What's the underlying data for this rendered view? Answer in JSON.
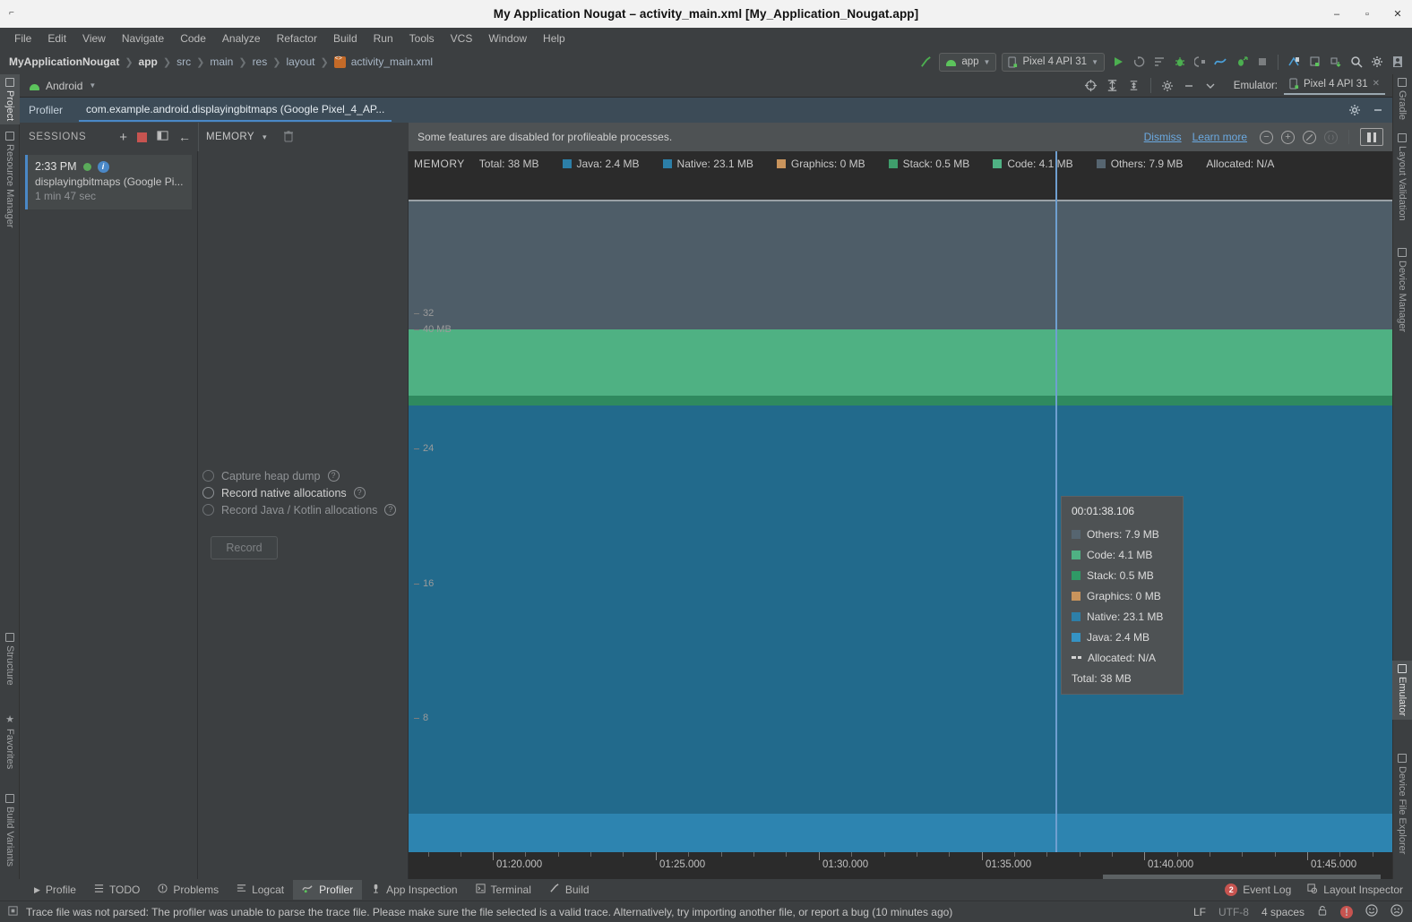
{
  "window": {
    "title": "My Application Nougat – activity_main.xml [My_Application_Nougat.app]",
    "minimize": "‒",
    "maximize": "▫",
    "close": "✕"
  },
  "menu": [
    "File",
    "Edit",
    "View",
    "Navigate",
    "Code",
    "Analyze",
    "Refactor",
    "Build",
    "Run",
    "Tools",
    "VCS",
    "Window",
    "Help"
  ],
  "breadcrumbs": [
    "MyApplicationNougat",
    "app",
    "src",
    "main",
    "res",
    "layout",
    "activity_main.xml"
  ],
  "toolbar": {
    "run_config": "app",
    "device": "Pixel 4 API 31",
    "icons": [
      "build-hammer-icon",
      "run-icon",
      "run-coverage-icon",
      "profile-icon",
      "debug-icon",
      "attach-debugger-icon",
      "profiler-graph-icon",
      "run-with-profiler-icon",
      "stop-icon",
      "avd-manager-icon",
      "layout-inspector-icon",
      "sdk-manager-icon",
      "search-icon",
      "settings-gear-icon",
      "user-avatar-icon"
    ]
  },
  "android_window": {
    "title": "Android",
    "emulator_label": "Emulator:",
    "emulator_tab": "Pixel 4 API 31",
    "tab_close": "✕"
  },
  "profiler_window": {
    "title": "Profiler",
    "selected_process": "com.example.android.displayingbitmaps (Google Pixel_4_AP...",
    "settings_icon": "gear-icon",
    "minimize_icon": "minimize-icon"
  },
  "sessions": {
    "header": "SESSIONS",
    "add_label": "+",
    "stop_label": "stop-recording-icon",
    "split_label": "split-view-icon",
    "back_label": "←",
    "items": [
      {
        "time": "2:33 PM",
        "name": "displayingbitmaps (Google Pi...",
        "duration": "1 min 47 sec"
      }
    ]
  },
  "memory_selector": {
    "label": "MEMORY",
    "caret": "▾",
    "trash_icon": "trash-icon"
  },
  "banner": {
    "message": "Some features are disabled for profileable processes.",
    "dismiss": "Dismiss",
    "learn_more": "Learn more",
    "zoom_out": "−",
    "zoom_in": "+",
    "reset_zoom": "⦸",
    "attach_live": "⟨⟩",
    "pause": "pause-icon"
  },
  "record_panel": {
    "options": [
      {
        "label": "Capture heap dump",
        "enabled": false,
        "help": "?"
      },
      {
        "label": "Record native allocations",
        "enabled": true,
        "help": "?"
      },
      {
        "label": "Record Java / Kotlin allocations",
        "enabled": false,
        "help": "?"
      }
    ],
    "record_button": "Record"
  },
  "chart_data": {
    "type": "area",
    "title": "MEMORY",
    "subtitle": "Total: 38 MB",
    "stacked": true,
    "ylabel": "",
    "xlabel": "",
    "ylim": [
      0,
      40
    ],
    "y_unit": "MB",
    "y_ticks": [
      {
        "value": 40,
        "label": "40 MB"
      },
      {
        "value": 32,
        "label": "32"
      },
      {
        "value": 24,
        "label": "24"
      },
      {
        "value": 16,
        "label": "16"
      },
      {
        "value": 8,
        "label": "8"
      }
    ],
    "x_ticks": [
      "01:20.000",
      "01:25.000",
      "01:30.000",
      "01:35.000",
      "01:40.000",
      "01:45.000"
    ],
    "grid": false,
    "legend_position": "top",
    "legend": [
      {
        "name": "Total",
        "value": "38 MB",
        "label": "Total: 38 MB",
        "color": ""
      },
      {
        "name": "Java",
        "value": "2.4 MB",
        "label": "Java: 2.4 MB",
        "color": "#2c7fa8"
      },
      {
        "name": "Native",
        "value": "23.1 MB",
        "label": "Native: 23.1 MB",
        "color": "#2c7fa8"
      },
      {
        "name": "Graphics",
        "value": "0 MB",
        "label": "Graphics: 0 MB",
        "color": "#c9945c"
      },
      {
        "name": "Stack",
        "value": "0.5 MB",
        "label": "Stack: 0.5 MB",
        "color": "#3f9e6c"
      },
      {
        "name": "Code",
        "value": "4.1 MB",
        "label": "Code: 4.1 MB",
        "color": "#4fb183"
      },
      {
        "name": "Others",
        "value": "7.9 MB",
        "label": "Others: 7.9 MB",
        "color": "#566570"
      },
      {
        "name": "Allocated",
        "value": "N/A",
        "label": "Allocated: N/A",
        "color": ""
      }
    ],
    "series": [
      {
        "name": "Java",
        "values": [
          2.4
        ],
        "color": "#2d84b0",
        "mb": 2.4
      },
      {
        "name": "Native",
        "values": [
          23.1
        ],
        "color": "#226a8c",
        "mb": 23.1
      },
      {
        "name": "Graphics",
        "values": [
          0
        ],
        "color": "#c9945c",
        "mb": 0
      },
      {
        "name": "Stack",
        "values": [
          0.5
        ],
        "color": "#2f8a5f",
        "mb": 0.5
      },
      {
        "name": "Code",
        "values": [
          4.1
        ],
        "color": "#4fb183",
        "mb": 4.1
      },
      {
        "name": "Others",
        "values": [
          7.9
        ],
        "color": "#4e5d68",
        "mb": 7.9
      }
    ],
    "total": 38,
    "allocated": "N/A"
  },
  "tooltip": {
    "time": "00:01:38.106",
    "rows": [
      {
        "label": "Others: 7.9 MB",
        "color": "#566570"
      },
      {
        "label": "Code: 4.1 MB",
        "color": "#4fb183"
      },
      {
        "label": "Stack: 0.5 MB",
        "color": "#2f9a66"
      },
      {
        "label": "Graphics: 0 MB",
        "color": "#c9945c"
      },
      {
        "label": "Native: 23.1 MB",
        "color": "#2d7fa8"
      },
      {
        "label": "Java: 2.4 MB",
        "color": "#3593c4"
      },
      {
        "label": "Allocated: N/A",
        "color": "dashed"
      }
    ],
    "total": "Total: 38 MB"
  },
  "left_strip": [
    {
      "label": "Project",
      "icon": "folder-icon",
      "active": true
    },
    {
      "label": "Resource Manager",
      "icon": "resource-icon",
      "active": false
    },
    {
      "label": "Structure",
      "icon": "structure-icon",
      "active": false
    },
    {
      "label": "Favorites",
      "icon": "star-icon",
      "active": false
    },
    {
      "label": "Build Variants",
      "icon": "variants-icon",
      "active": false
    }
  ],
  "right_strip": [
    {
      "label": "Gradle",
      "icon": "gradle-elephant-icon",
      "active": false
    },
    {
      "label": "Layout Validation",
      "icon": "layout-validation-icon",
      "active": false
    },
    {
      "label": "Device Manager",
      "icon": "device-manager-icon",
      "active": false
    },
    {
      "label": "Emulator",
      "icon": "emulator-icon",
      "active": true
    },
    {
      "label": "Device File Explorer",
      "icon": "device-file-icon",
      "active": false
    }
  ],
  "bottom_tabs": [
    {
      "label": "Profile",
      "icon": "play-icon",
      "active": false
    },
    {
      "label": "TODO",
      "icon": "list-icon",
      "active": false
    },
    {
      "label": "Problems",
      "icon": "warning-icon",
      "active": false
    },
    {
      "label": "Logcat",
      "icon": "logcat-icon",
      "active": false
    },
    {
      "label": "Profiler",
      "icon": "profiler-icon",
      "active": true
    },
    {
      "label": "App Inspection",
      "icon": "inspection-icon",
      "active": false
    },
    {
      "label": "Terminal",
      "icon": "terminal-icon",
      "active": false
    },
    {
      "label": "Build",
      "icon": "build-hammer-icon",
      "active": false
    }
  ],
  "bottom_right": {
    "event_log_count": "2",
    "event_log": "Event Log",
    "layout_inspector": "Layout Inspector"
  },
  "statusbar": {
    "message": "Trace file was not parsed: The profiler was unable to parse the trace file. Please make sure the file selected is a valid trace. Alternatively, try importing another file, or report a bug (10 minutes ago)",
    "line_sep": "LF",
    "encoding": "UTF-8",
    "indent": "4 spaces",
    "lock_icon": "lock-icon",
    "error_icon": "error-icon",
    "smiley_icon": "smiley-icon",
    "frowny_icon": "frowny-icon"
  }
}
